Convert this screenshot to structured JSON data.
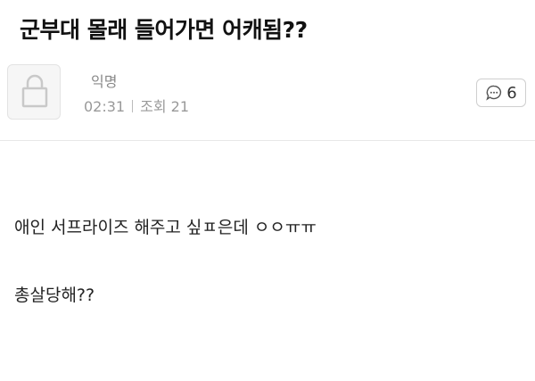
{
  "post": {
    "title": "군부대 몰래 들어가면 어캐됨??",
    "author": "익명",
    "time": "02:31",
    "views": "조회 21",
    "comment_count": "6",
    "body": [
      "애인 서프라이즈 해주고 싶ㅍ은데 ㅇㅇㅠㅠ",
      "총살당해??"
    ]
  },
  "icons": {
    "avatar": "lock-icon",
    "comment": "speech-bubble-icon"
  },
  "colors": {
    "title": "#111111",
    "meta": "#999999",
    "border": "#e3e3e3"
  }
}
